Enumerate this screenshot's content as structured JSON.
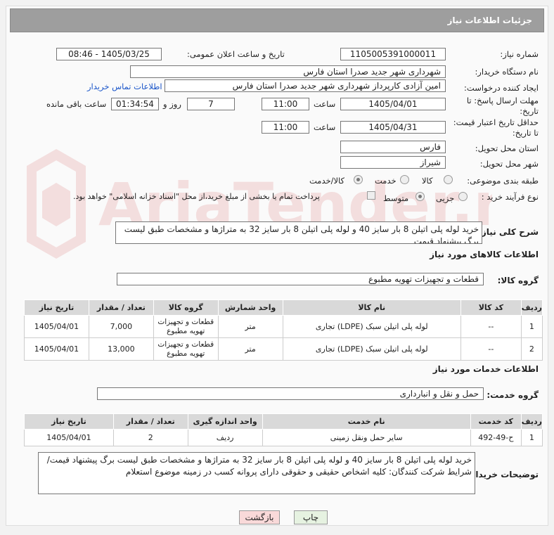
{
  "header": {
    "title": "جزئیات اطلاعات نیاز"
  },
  "form": {
    "need_number_label": "شماره نیاز:",
    "need_number": "1105005391000011",
    "announce_label": "تاریخ و ساعت اعلان عمومی:",
    "announce_value": "1405/03/25 - 08:46",
    "buyer_org_label": "نام دستگاه خریدار:",
    "buyer_org": "شهرداری شهر جدید صدرا استان فارس",
    "creator_label": "ایجاد کننده درخواست:",
    "creator": "امین آزادی کارپرداز شهرداری شهر جدید صدرا استان فارس",
    "contact_link": "اطلاعات تماس خریدار",
    "deadline_label": "مهلت ارسال پاسخ: تا تاریخ:",
    "deadline_date": "1405/04/01",
    "time_label": "ساعت",
    "deadline_time": "11:00",
    "days_value": "7",
    "day_and_label": "روز و",
    "remaining_time": "01:34:54",
    "remaining_label": "ساعت باقی مانده",
    "price_validity_label": "حداقل تاریخ اعتبار قیمت: تا تاریخ:",
    "price_validity_date": "1405/04/31",
    "price_validity_time": "11:00",
    "province_label": "استان محل تحویل:",
    "province": "فارس",
    "city_label": "شهر محل تحویل:",
    "city": "شیراز",
    "category_label": "طبقه بندی موضوعی:",
    "category_options": [
      "کالا",
      "خدمت",
      "کالا/خدمت"
    ],
    "category_selected": "کالا/خدمت",
    "process_label": "نوع فرآیند خرید :",
    "process_options": [
      "جزیی",
      "متوسط"
    ],
    "process_selected": "متوسط",
    "payment_note": "پرداخت تمام یا بخشی از مبلغ خرید،از محل \"اسناد خزانه اسلامی\" خواهد بود."
  },
  "description": {
    "label": "شرح کلی نیاز:",
    "text": "خرید لوله پلی اتیلن 8 بار سایز 40 و لوله پلی اتیلن 8 بار سایز 32 به متراژها و مشخصات طبق لیست برگ پیشنهاد قیمت"
  },
  "goods": {
    "section_title": "اطلاعات کالاهای مورد نیاز",
    "group_label": "گروه کالا:",
    "group_value": "قطعات و تجهیزات تهویه مطبوع",
    "columns": [
      "ردیف",
      "کد کالا",
      "نام کالا",
      "واحد شمارش",
      "گروه کالا",
      "تعداد / مقدار",
      "تاریخ نیاز"
    ],
    "rows": [
      {
        "row": "1",
        "code": "--",
        "name": "لوله پلی اتیلن سبک (LDPE) تجاری",
        "unit": "متر",
        "group": "قطعات و تجهیزات تهویه مطبوع",
        "qty": "7,000",
        "date": "1405/04/01"
      },
      {
        "row": "2",
        "code": "--",
        "name": "لوله پلی اتیلن سبک (LDPE) تجاری",
        "unit": "متر",
        "group": "قطعات و تجهیزات تهویه مطبوع",
        "qty": "13,000",
        "date": "1405/04/01"
      }
    ]
  },
  "services": {
    "section_title": "اطلاعات خدمات مورد نیاز",
    "group_label": "گروه خدمت:",
    "group_value": "حمل و نقل و انبارداری",
    "columns": [
      "ردیف",
      "کد خدمت",
      "نام خدمت",
      "واحد اندازه گیری",
      "تعداد / مقدار",
      "تاریخ نیاز"
    ],
    "rows": [
      {
        "row": "1",
        "code": "ح-49-492",
        "name": "سایر حمل ونقل زمینی",
        "unit": "ردیف",
        "qty": "2",
        "date": "1405/04/01"
      }
    ]
  },
  "buyer_notes": {
    "label": "توضیحات خریدار:",
    "text": "خرید لوله پلی اتیلن 8 بار سایز 40 و لوله پلی اتیلن 8 بار سایز 32 به متراژها و مشخصات طبق لیست برگ پیشنهاد قیمت/ شرایط شرکت کنندگان: کلیه اشخاص حقیقی و حقوقی دارای پروانه کسب در زمینه موضوع استعلام"
  },
  "buttons": {
    "print": "چاپ",
    "back": "بازگشت"
  },
  "watermark_text": "AriaTender.neT",
  "colors": {
    "header_bg": "#9e9e9e",
    "table_header_bg": "#d9d9d9",
    "link": "#1a55c9",
    "back_button_bg": "#f9d9d9",
    "print_button_bg": "#e6f2e1"
  }
}
